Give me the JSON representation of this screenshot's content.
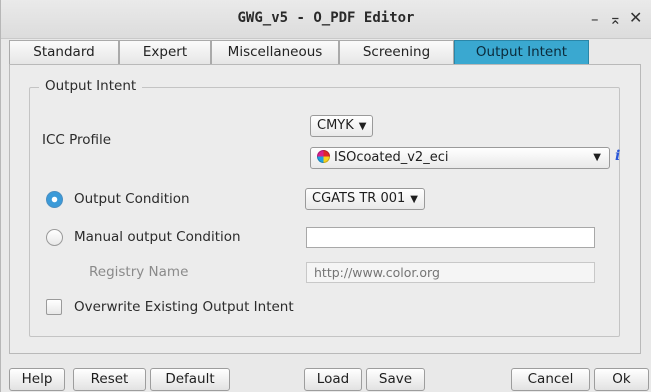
{
  "window": {
    "title": "GWG_v5 - O_PDF Editor",
    "minimize": "–",
    "maximize": "㉖",
    "close": "✕"
  },
  "tabs": [
    {
      "label": "Standard",
      "active": false
    },
    {
      "label": "Expert",
      "active": false
    },
    {
      "label": "Miscellaneous",
      "active": false
    },
    {
      "label": "Screening",
      "active": false
    },
    {
      "label": "Output Intent",
      "active": true
    }
  ],
  "group": {
    "legend": "Output Intent"
  },
  "icc": {
    "label": "ICC Profile",
    "colorspace": "CMYK",
    "profile": "ISOcoated_v2_eci",
    "info_icon": "i"
  },
  "output_condition": {
    "label": "Output Condition",
    "selected": true,
    "value": "CGATS TR 001"
  },
  "manual_condition": {
    "label": "Manual output Condition",
    "selected": false,
    "value": ""
  },
  "registry": {
    "label": "Registry Name",
    "placeholder": "http://www.color.org"
  },
  "overwrite": {
    "label": "Overwrite Existing Output Intent",
    "checked": false
  },
  "buttons": {
    "help": "Help",
    "reset": "Reset",
    "default": "Default",
    "load": "Load",
    "save": "Save",
    "cancel": "Cancel",
    "ok": "Ok"
  },
  "colors": {
    "active_tab": "#3aa8d0",
    "radio_selected": "#3b9ad8",
    "info_icon": "#2a57d8"
  }
}
